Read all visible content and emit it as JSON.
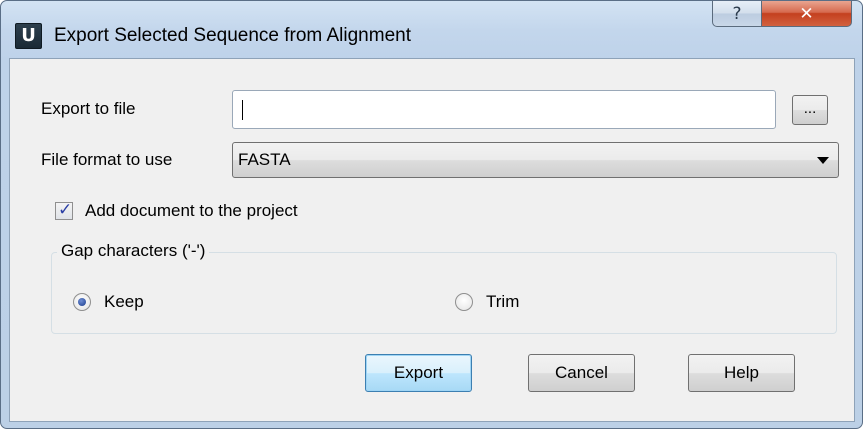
{
  "window": {
    "title": "Export Selected Sequence from Alignment",
    "app_icon_letter": "U",
    "help_glyph": "?",
    "close_glyph": "✕"
  },
  "form": {
    "export_label": "Export to file",
    "export_value": "",
    "browse_label": "...",
    "format_label": "File format to use",
    "format_value": "FASTA",
    "add_doc_label": "Add document to the project",
    "add_doc_checked": true
  },
  "gap": {
    "title": "Gap characters ('-')",
    "options": [
      {
        "label": "Keep",
        "selected": true
      },
      {
        "label": "Trim",
        "selected": false
      }
    ]
  },
  "buttons": {
    "export": "Export",
    "cancel": "Cancel",
    "help": "Help"
  },
  "icons": {
    "app": "app-icon",
    "help": "help-icon",
    "close": "close-icon",
    "checkbox": "checkmark-icon",
    "dropdown": "chevron-down-icon"
  },
  "colors": {
    "title_bar": "#c3d6ec",
    "close_button": "#c4401f",
    "default_button": "#bee6fd",
    "dialog_background": "#f0f0f0"
  }
}
